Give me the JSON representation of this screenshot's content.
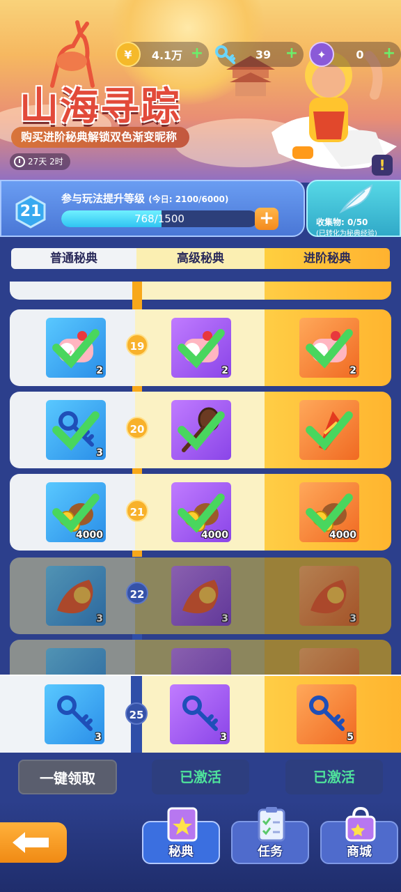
{
  "currencies": [
    {
      "icon": "coin-icon",
      "value": "4.1万"
    },
    {
      "icon": "key-icon",
      "value": "39"
    },
    {
      "icon": "token-icon",
      "value": "0"
    }
  ],
  "hero": {
    "title": "山海寻踪",
    "subtitle": "购买进阶秘典解锁双色渐变昵称",
    "timer": "27天 2时"
  },
  "level": {
    "current": "21",
    "label": "参与玩法提升等级",
    "today": "(今日: 2100/6000)",
    "xp_text": "768/1500",
    "xp_fraction": 0.512
  },
  "collect": {
    "count": "收集物: 0/50",
    "note": "(已转化为秘典经验)"
  },
  "tabs": {
    "normal": "普通秘典",
    "advanced": "高级秘典",
    "premium": "进阶秘典"
  },
  "rows": [
    {
      "level": "19",
      "qty": [
        "2",
        "2",
        "2"
      ]
    },
    {
      "level": "20",
      "qty": [
        "3",
        "",
        ""
      ]
    },
    {
      "level": "21",
      "qty": [
        "4000",
        "4000",
        "4000"
      ]
    },
    {
      "level": "22",
      "qty": [
        "3",
        "3",
        "3"
      ]
    },
    {
      "level": "25",
      "qty": [
        "3",
        "3",
        "5"
      ]
    }
  ],
  "buttons": {
    "claim_all": "一键领取",
    "activated_adv": "已激活",
    "activated_pre": "已激活"
  },
  "nav": {
    "tab1": "秘典",
    "tab2": "任务",
    "tab3": "商城"
  },
  "colors": {
    "accent_orange": "#f8a81a",
    "activated_green": "#4fe29b",
    "title_red": "#e24a3a"
  }
}
